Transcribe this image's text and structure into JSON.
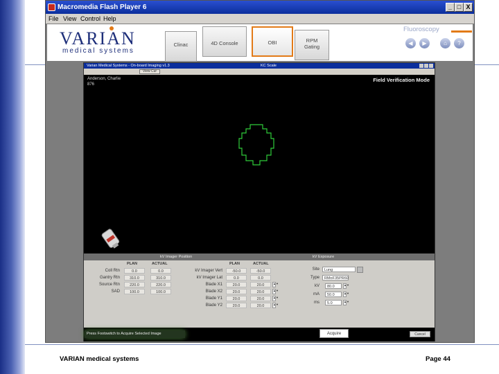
{
  "window": {
    "title": "Macromedia Flash Player 6",
    "menu": [
      "File",
      "View",
      "Control",
      "Help"
    ],
    "controls": [
      "_",
      "□",
      "X"
    ]
  },
  "header": {
    "logo_word": "VARIAN",
    "logo_sub": "medical systems",
    "tabs": [
      {
        "label": "Clinac",
        "line2": ""
      },
      {
        "label": "4D Console",
        "line2": ""
      },
      {
        "label": "OBI",
        "line2": ""
      },
      {
        "label": "RPM",
        "line2": "Gating"
      }
    ],
    "active_tab": "OBI",
    "section": "Fluoroscopy",
    "nav_icons": [
      "back-icon",
      "forward-icon",
      "home-icon",
      "help-icon"
    ],
    "help_glyph": "?"
  },
  "obi": {
    "title": "Varian Medical Systems - On-board Imaging v1.3",
    "title_right": "KC Scale",
    "toolbar_button": "View Cur",
    "patient_name": "Anderson, Charlie",
    "patient_id": "876",
    "mode": "Field Verification Mode",
    "left_section": "kV Imager Position",
    "right_section": "kV Exposure",
    "col_plan": "PLAN",
    "col_actual": "ACTUAL",
    "gantry_rows": [
      {
        "label": "Coll Rtn",
        "plan": "0.0",
        "actual": "0.0"
      },
      {
        "label": "Gantry Rtn",
        "plan": "310.0",
        "actual": "310.0"
      },
      {
        "label": "Source Rtn",
        "plan": "220.0",
        "actual": "220.0"
      },
      {
        "label": "SAD",
        "plan": "100.0",
        "actual": "100.0"
      }
    ],
    "blade_rows": [
      {
        "label": "kV Imager Vert",
        "plan": "-50.0",
        "actual": "-50.0"
      },
      {
        "label": "kV Imager Lat",
        "plan": "0.0",
        "actual": "0.0"
      },
      {
        "label": "Blade X1",
        "plan": "20.0",
        "actual": "20.0"
      },
      {
        "label": "Blade X2",
        "plan": "20.0",
        "actual": "20.0"
      },
      {
        "label": "Blade Y1",
        "plan": "20.0",
        "actual": "20.0"
      },
      {
        "label": "Blade Y2",
        "plan": "20.0",
        "actual": "20.0"
      }
    ],
    "exposure": {
      "site_label": "Site",
      "site_value": "Lung",
      "type_label": "Type",
      "type_value": "RMoF35PR60",
      "kv_label": "kV",
      "kv_value": "80.0",
      "ma_label": "mA",
      "ma_value": "50.0",
      "ms_label": "ms",
      "ms_value": "5.0"
    },
    "status_message": "Press Footswitch to Acquire Selected Image",
    "acquire_button": "Acquire",
    "cancel_button": "Cancel"
  },
  "footer": {
    "left": "VARIAN medical systems",
    "right": "Page 44"
  },
  "colors": {
    "stripe": "#1a2f86",
    "titlebar": "#0b2e9c",
    "accent": "#e27a17",
    "field_outline": "#2fcc3a"
  }
}
